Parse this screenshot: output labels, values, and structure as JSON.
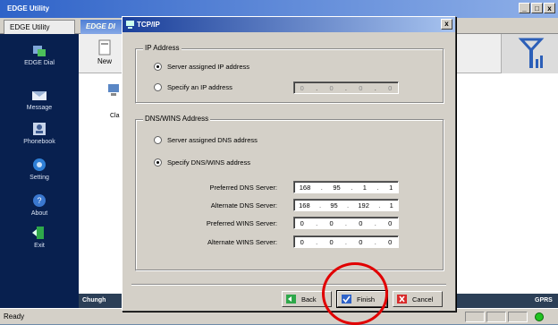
{
  "app": {
    "title": "EDGE Utility",
    "tabs": [
      {
        "label": "EDGE Utility"
      },
      {
        "label": "EDGE DI"
      }
    ],
    "window_controls": [
      "_",
      "□",
      "x"
    ]
  },
  "sidebar": {
    "items": [
      {
        "label": "EDGE Dial",
        "icon": "dial-icon"
      },
      {
        "label": "Message",
        "icon": "message-icon"
      },
      {
        "label": "Phonebook",
        "icon": "phonebook-icon"
      },
      {
        "label": "Setting",
        "icon": "setting-icon"
      },
      {
        "label": "About",
        "icon": "about-icon"
      },
      {
        "label": "Exit",
        "icon": "exit-icon"
      }
    ]
  },
  "toolbar": {
    "new_label": "New",
    "cl_label": "Cla"
  },
  "chat_bar": {
    "label": "Chungh"
  },
  "status": {
    "left": "Ready",
    "network": "GPRS"
  },
  "dialog": {
    "title": "TCP/IP",
    "close": "x",
    "ip_group": {
      "label": "IP Address",
      "radio_server": "Server assigned IP address",
      "radio_specify": "Specify an IP address",
      "ip_value": [
        "0",
        "0",
        "0",
        "0"
      ],
      "selected": "server"
    },
    "dns_group": {
      "label": "DNS/WINS Address",
      "radio_server": "Server assigned DNS address",
      "radio_specify": "Specify DNS/WINS address",
      "selected": "specify",
      "fields": [
        {
          "label": "Preferred DNS Server:",
          "value": [
            "168",
            "95",
            "1",
            "1"
          ]
        },
        {
          "label": "Alternate DNS Server:",
          "value": [
            "168",
            "95",
            "192",
            "1"
          ]
        },
        {
          "label": "Preferred WINS Server:",
          "value": [
            "0",
            "0",
            "0",
            "0"
          ]
        },
        {
          "label": "Alternate WINS Server:",
          "value": [
            "0",
            "0",
            "0",
            "0"
          ]
        }
      ]
    },
    "buttons": {
      "back": "Back",
      "finish": "Finish",
      "cancel": "Cancel"
    }
  },
  "colors": {
    "highlight_circle": "#e10000",
    "sidebar_bg": "#08204f"
  }
}
